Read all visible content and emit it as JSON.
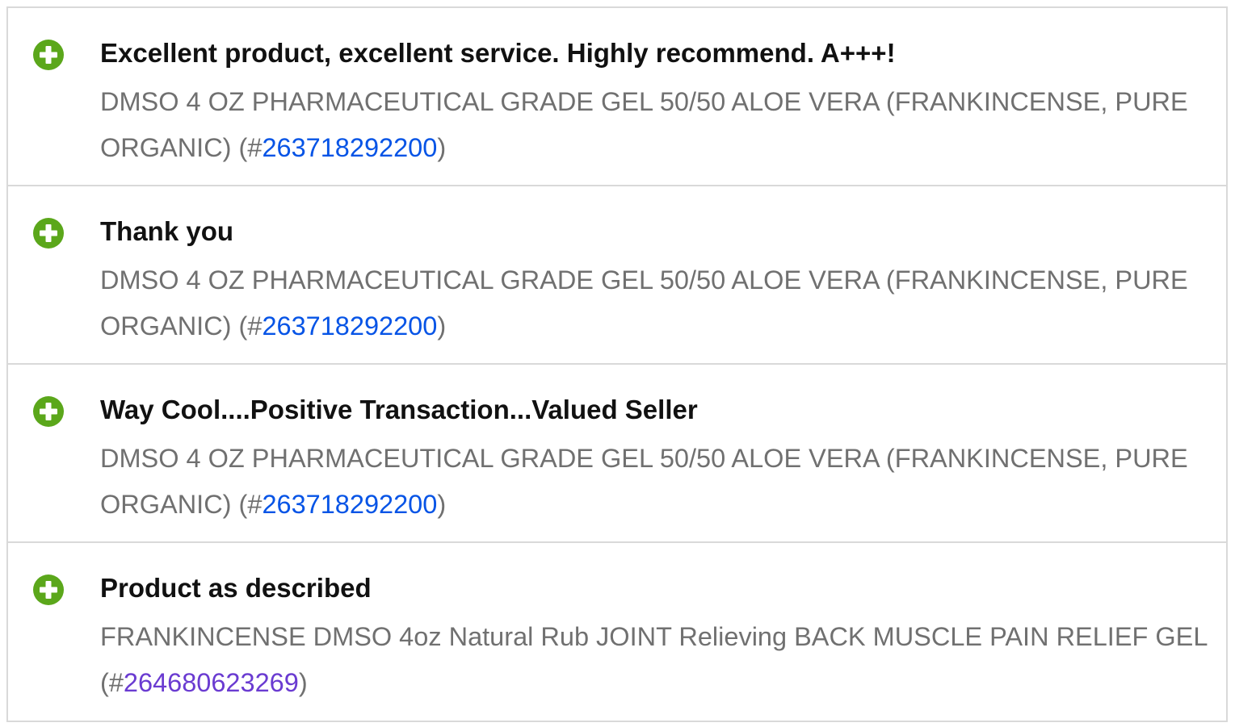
{
  "feedback": [
    {
      "comment": "Excellent product, excellent service. Highly recommend. A+++!",
      "item_title": "DMSO 4 OZ PHARMACEUTICAL GRADE GEL 50/50 ALOE VERA (FRANKINCENSE, PURE ORGANIC) (#",
      "item_number": "263718292200",
      "item_suffix": ")"
    },
    {
      "comment": "Thank you",
      "item_title": "DMSO 4 OZ PHARMACEUTICAL GRADE GEL 50/50 ALOE VERA (FRANKINCENSE, PURE ORGANIC) (#",
      "item_number": "263718292200",
      "item_suffix": ")"
    },
    {
      "comment": "Way Cool....Positive Transaction...Valued Seller",
      "item_title": "DMSO 4 OZ PHARMACEUTICAL GRADE GEL 50/50 ALOE VERA (FRANKINCENSE, PURE ORGANIC) (#",
      "item_number": "263718292200",
      "item_suffix": ")"
    },
    {
      "comment": "Product as described",
      "item_title": "FRANKINCENSE DMSO 4oz Natural Rub JOINT Relieving BACK MUSCLE PAIN RELIEF GEL (#",
      "item_number": "264680623269",
      "item_suffix": ")"
    }
  ],
  "icon": "positive-feedback-plus-icon",
  "colors": {
    "positive": "#5ba71b",
    "link": "#0654e6",
    "visited_link": "#6a3bd1",
    "item_text": "#707070",
    "comment_text": "#111111",
    "divider": "#d9d9d9"
  }
}
